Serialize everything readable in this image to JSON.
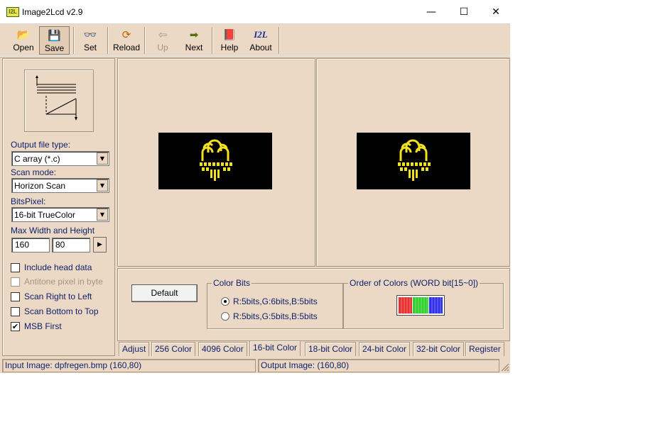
{
  "window": {
    "icon_label": "I2L",
    "title": "Image2Lcd v2.9",
    "minimize_glyph": "—",
    "maximize_glyph": "☐",
    "close_glyph": "✕"
  },
  "toolbar": {
    "buttons": [
      {
        "label": "Open",
        "icon": "open-folder-icon",
        "glyph": "📂",
        "color": "#b8860b"
      },
      {
        "label": "Save",
        "icon": "save-disk-icon",
        "glyph": "💾",
        "color": "#333333"
      },
      {
        "label": "Set",
        "icon": "glasses-icon",
        "glyph": "👓",
        "color": "#c07000"
      },
      {
        "label": "Reload",
        "icon": "reload-icon",
        "glyph": "⟳",
        "color": "#c06000"
      },
      {
        "label": "Up",
        "icon": "up-arrow-icon",
        "glyph": "⇦",
        "color": "#a59483"
      },
      {
        "label": "Next",
        "icon": "next-arrow-icon",
        "glyph": "➡",
        "color": "#5a6e10"
      },
      {
        "label": "Help",
        "icon": "help-book-icon",
        "glyph": "📕",
        "color": "#a01030"
      },
      {
        "label": "About",
        "icon": "i2l-logo-icon",
        "glyph": "I2L",
        "color": "#1b2a9a"
      }
    ]
  },
  "left_panel": {
    "output_file_type_label": "Output file type:",
    "output_file_type_value": "C array (*.c)",
    "scan_mode_label": "Scan mode:",
    "scan_mode_value": "Horizon Scan",
    "bits_pixel_label": "BitsPixel:",
    "bits_pixel_value": "16-bit TrueColor",
    "max_size_label": "Max Width and Height",
    "max_width": "160",
    "max_height": "80",
    "spin_glyph": "▶",
    "combo_arrow": "▼",
    "checkboxes": [
      {
        "label": "Include head data",
        "checked": false,
        "enabled": true
      },
      {
        "label": "Antitone pixel in byte",
        "checked": false,
        "enabled": false
      },
      {
        "label": "Scan Right to Left",
        "checked": false,
        "enabled": true
      },
      {
        "label": "Scan Bottom to Top",
        "checked": false,
        "enabled": true
      },
      {
        "label": "MSB First",
        "checked": true,
        "enabled": true
      }
    ],
    "check_mark": "✔"
  },
  "settings": {
    "default_button": "Default",
    "color_bits_title": "Color Bits",
    "color_bits_options": [
      {
        "label": "R:5bits,G:6bits,B:5bits",
        "selected": true
      },
      {
        "label": "R:5bits,G:5bits,B:5bits",
        "selected": false
      }
    ],
    "order_title": "Order of Colors (WORD bit[15~0])",
    "order_colors": [
      "#e83030",
      "#30d030",
      "#3030e8"
    ]
  },
  "tabs": [
    {
      "label": "Adjust",
      "active": false
    },
    {
      "label": "256 Color",
      "active": false
    },
    {
      "label": "4096 Color",
      "active": false
    },
    {
      "label": "16-bit Color",
      "active": true
    },
    {
      "label": "18-bit Color",
      "active": false
    },
    {
      "label": "24-bit Color",
      "active": false
    },
    {
      "label": "32-bit Color",
      "active": false
    },
    {
      "label": "Register",
      "active": false
    }
  ],
  "status": {
    "input_image": "Input Image: dpfregen.bmp (160,80)",
    "output_image": "Output Image: (160,80)"
  },
  "colors": {
    "face": "#ecd9c5",
    "label_text": "#0b1f6b",
    "symbol_yellow": "#f2e21d"
  }
}
